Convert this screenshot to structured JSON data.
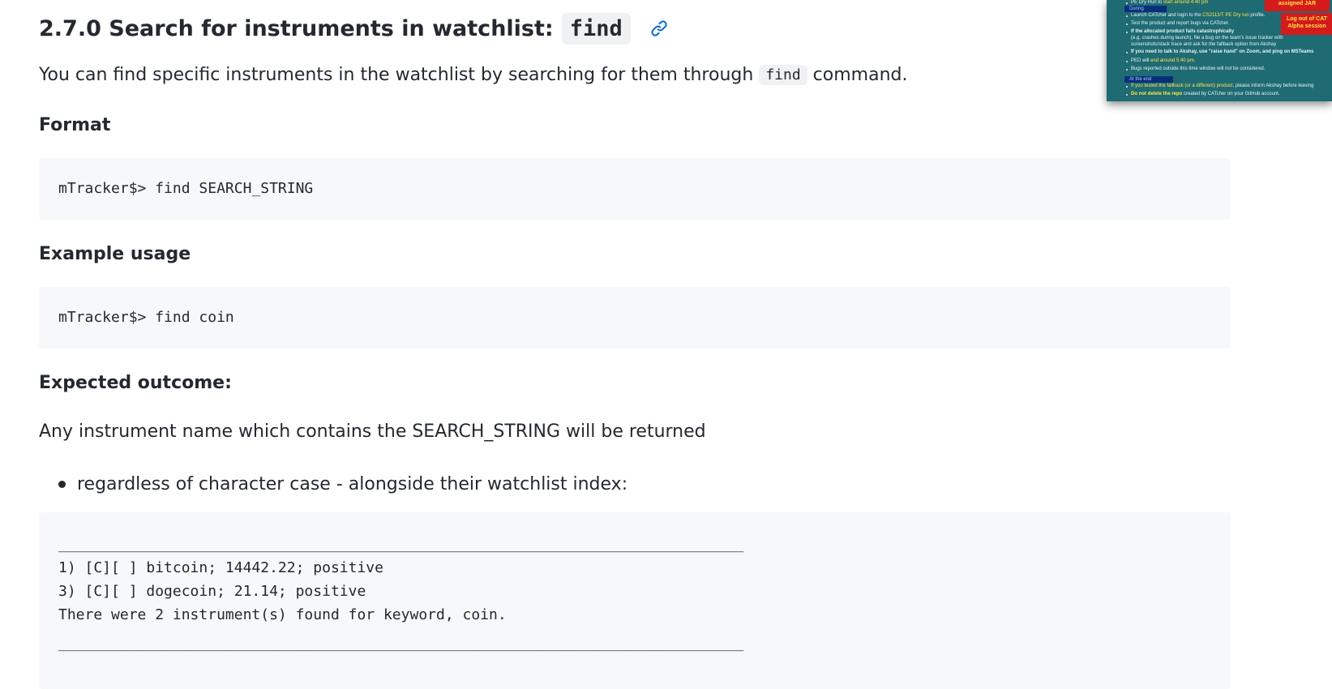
{
  "heading": {
    "title": "2.7.0 Search for instruments in watchlist:",
    "code": "find",
    "link_icon": "link-icon"
  },
  "intro": {
    "before": "You can find specific instruments in the watchlist by searching for them through",
    "code": "find",
    "after": "command."
  },
  "format": {
    "label": "Format",
    "code": "mTracker$> find SEARCH_STRING"
  },
  "example": {
    "label": "Example usage",
    "code": "mTracker$> find coin"
  },
  "outcome": {
    "label": "Expected outcome:",
    "text": "Any instrument name which contains the SEARCH_STRING will be returned",
    "bullet": "regardless of character case - alongside their watchlist index:",
    "code_lines": [
      "______________________________________________________________________________",
      "1) [C][ ] bitcoin; 14442.22; positive",
      "3) [C][ ] dogecoin; 21.14; positive",
      "There were 2 instrument(s) found for keyword, coin.",
      "______________________________________________________________________________"
    ]
  },
  "thumbnail": {
    "lines": [
      {
        "text": "PE Dry Run to ",
        "hl": "start around 4:40 pm"
      },
      {
        "text": "Launch CATcher and login to the ",
        "hl": "CS2113/T PE Dry run",
        "tail": " profile."
      },
      {
        "text": "Test the product and report bugs via CATcher."
      },
      {
        "text": "If the allocated product fails catastrophically"
      },
      {
        "text": "(e.g. crashes during launch), file a bug on the team's issue tracker with"
      },
      {
        "text": "screenshots/stack trace and ask for the fallback option from Akshay"
      },
      {
        "text": "If you need to talk to Akshay, use \"raise hand\" on Zoom, and ping on MSTeams"
      },
      {
        "text": "PED will ",
        "hl": "end around 5:40 pm."
      },
      {
        "text": "Bugs reported outside this time window will not be considered."
      },
      {
        "text": "",
        "hl": "If you tested the fallback (or a different) product,",
        "tail": " please inform Akshay before leaving"
      },
      {
        "text": "",
        "hl": "Do not delete the repo",
        "tail": " created by CATcher on your GitHub account."
      }
    ],
    "section_during": "During",
    "section_end": "At the end",
    "box_jar": "assigned JAR",
    "box_logout_1": "Log out of CAT",
    "box_logout_2": "Alpha session"
  }
}
